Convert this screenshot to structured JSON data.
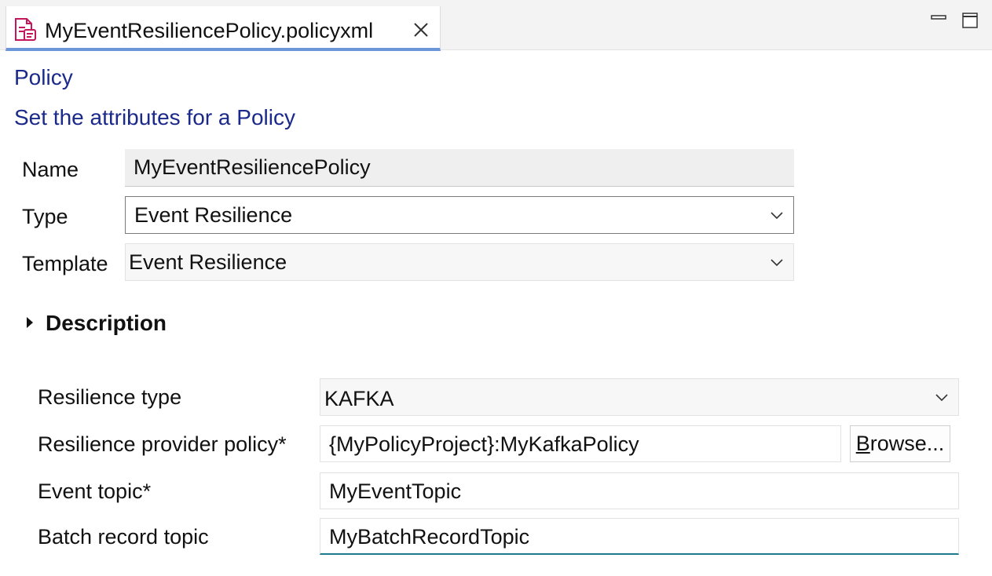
{
  "tab": {
    "title": "MyEventResiliencePolicy.policyxml",
    "icon": "policy-file-icon",
    "close_icon": "close-icon"
  },
  "window_controls": {
    "minimize_icon": "minimize-icon",
    "maximize_icon": "maximize-icon"
  },
  "header": {
    "title": "Policy",
    "subtitle": "Set the attributes for a Policy",
    "color": "#1b2a8a"
  },
  "form": {
    "name": {
      "label": "Name",
      "value": "MyEventResiliencePolicy"
    },
    "type": {
      "label": "Type",
      "value": "Event Resilience"
    },
    "template": {
      "label": "Template",
      "value": "Event Resilience"
    }
  },
  "description": {
    "label": "Description",
    "expanded": false
  },
  "properties": {
    "resilience_type": {
      "label": "Resilience type",
      "value": "KAFKA"
    },
    "provider_policy": {
      "label": "Resilience provider policy*",
      "value": "{MyPolicyProject}:MyKafkaPolicy"
    },
    "browse": {
      "mnemonic": "B",
      "rest": "rowse..."
    },
    "event_topic": {
      "label": "Event topic*",
      "value": "MyEventTopic"
    },
    "batch_topic": {
      "label": "Batch record topic",
      "value": "MyBatchRecordTopic"
    }
  },
  "colors": {
    "accent_tab": "#6a95d8",
    "focus_underline": "#1f7a8c"
  }
}
